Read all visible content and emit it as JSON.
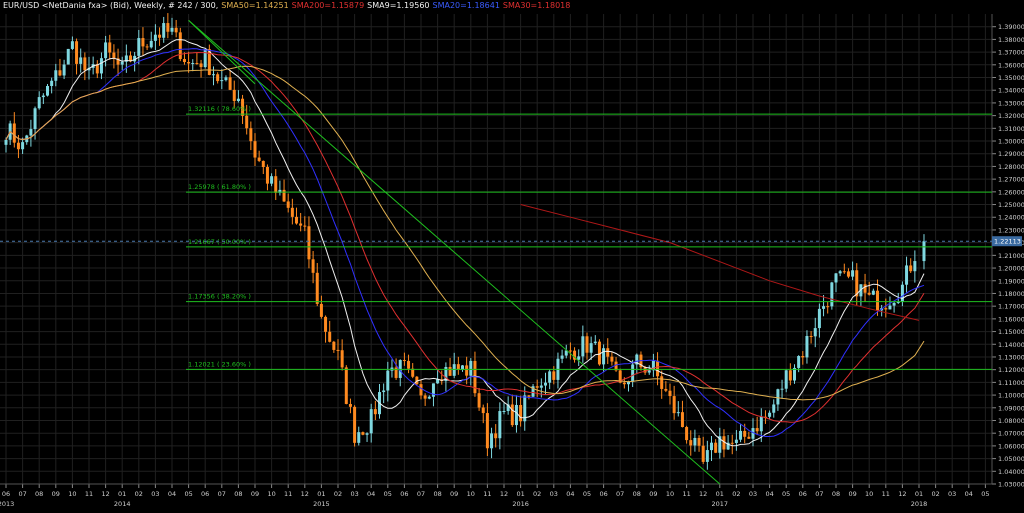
{
  "header": {
    "symbol": "EUR/USD <NetDania fxa> (Bid), Weekly, # 242 / 300,",
    "sma50": "SMA50=1.14251",
    "sma200": "SMA200=1.15879",
    "sma9": "SMA9=1.19560",
    "sma20": "SMA20=1.18641",
    "sma30": "SMA30=1.18018"
  },
  "colors": {
    "background": "#000000",
    "grid": "#202020",
    "bull": "#7fd8e0",
    "bear": "#ff8a20",
    "sma9": "#f0f0f0",
    "sma20": "#3030ff",
    "sma30": "#e03030",
    "sma50": "#e0b050",
    "sma200": "#b01818",
    "fib": "#1fbf1f",
    "price_box": "#3a6aa0"
  },
  "chart_data": {
    "type": "candlestick",
    "title": "EUR/USD <NetDania fxa> (Bid), Weekly, # 242 / 300,",
    "x_axis": {
      "months": [
        "06",
        "07",
        "08",
        "09",
        "10",
        "11",
        "12",
        "01",
        "02",
        "03",
        "04",
        "05",
        "06",
        "07",
        "08",
        "09",
        "10",
        "11",
        "12",
        "01",
        "02",
        "03",
        "04",
        "05",
        "06",
        "07",
        "08",
        "09",
        "10",
        "11",
        "12",
        "01",
        "02",
        "03",
        "04",
        "05",
        "06",
        "07",
        "08",
        "09",
        "10",
        "11",
        "12",
        "01",
        "02",
        "03",
        "04",
        "05",
        "06",
        "07",
        "08",
        "09",
        "10",
        "11",
        "12",
        "01",
        "02",
        "03",
        "04",
        "05"
      ],
      "years": [
        {
          "label": "2013",
          "at": "2013-06"
        },
        {
          "label": "2014",
          "at": "2014-01"
        },
        {
          "label": "2015",
          "at": "2015-01"
        },
        {
          "label": "2016",
          "at": "2016-01"
        },
        {
          "label": "2017",
          "at": "2017-01"
        },
        {
          "label": "2018",
          "at": "2018-01"
        }
      ],
      "start": "2013-06",
      "end": "2018-05"
    },
    "y_axis": {
      "min": 1.03,
      "max": 1.4,
      "step": 0.01,
      "side": "right",
      "ticks": [
        "1.03000",
        "1.04000",
        "1.05000",
        "1.06000",
        "1.07000",
        "1.08000",
        "1.09000",
        "1.10000",
        "1.11000",
        "1.12000",
        "1.13000",
        "1.14000",
        "1.15000",
        "1.16000",
        "1.17000",
        "1.18000",
        "1.19000",
        "1.20000",
        "1.21000",
        "1.22000",
        "1.23000",
        "1.24000",
        "1.25000",
        "1.26000",
        "1.27000",
        "1.28000",
        "1.29000",
        "1.30000",
        "1.31000",
        "1.32000",
        "1.33000",
        "1.34000",
        "1.35000",
        "1.36000",
        "1.37000",
        "1.38000",
        "1.39000"
      ]
    },
    "grid": true,
    "last_price": "1.22113",
    "last_price_value": 1.22113,
    "fib_levels": [
      {
        "label": "1.32116 ( 78.60% )",
        "value": 1.32116
      },
      {
        "label": "1.25978 ( 61.80% )",
        "value": 1.25978
      },
      {
        "label": "1.21667 ( 50.00% )",
        "value": 1.21667
      },
      {
        "label": "1.17356 ( 38.20% )",
        "value": 1.17356
      },
      {
        "label": "1.12021 ( 23.60% )",
        "value": 1.12021
      }
    ],
    "trendlines": [
      {
        "from": [
          "2014-05",
          1.395
        ],
        "to": [
          "2017-01",
          1.03
        ]
      },
      {
        "from": [
          "2014-05",
          1.395
        ],
        "to": [
          "2014-09",
          1.345
        ]
      }
    ],
    "price_path": [
      [
        "2013-06",
        1.31
      ],
      [
        "2013-07",
        1.295
      ],
      [
        "2013-08",
        1.33
      ],
      [
        "2013-09",
        1.35
      ],
      [
        "2013-10",
        1.375
      ],
      [
        "2013-11",
        1.35
      ],
      [
        "2013-12",
        1.37
      ],
      [
        "2014-01",
        1.355
      ],
      [
        "2014-02",
        1.375
      ],
      [
        "2014-03",
        1.385
      ],
      [
        "2014-04",
        1.385
      ],
      [
        "2014-05",
        1.36
      ],
      [
        "2014-06",
        1.365
      ],
      [
        "2014-07",
        1.345
      ],
      [
        "2014-08",
        1.335
      ],
      [
        "2014-09",
        1.29
      ],
      [
        "2014-10",
        1.265
      ],
      [
        "2014-11",
        1.245
      ],
      [
        "2014-12",
        1.225
      ],
      [
        "2015-01",
        1.16
      ],
      [
        "2015-02",
        1.13
      ],
      [
        "2015-03",
        1.07
      ],
      [
        "2015-04",
        1.08
      ],
      [
        "2015-05",
        1.12
      ],
      [
        "2015-06",
        1.12
      ],
      [
        "2015-07",
        1.095
      ],
      [
        "2015-08",
        1.12
      ],
      [
        "2015-09",
        1.12
      ],
      [
        "2015-10",
        1.12
      ],
      [
        "2015-11",
        1.065
      ],
      [
        "2015-12",
        1.085
      ],
      [
        "2016-01",
        1.085
      ],
      [
        "2016-02",
        1.11
      ],
      [
        "2016-03",
        1.12
      ],
      [
        "2016-04",
        1.135
      ],
      [
        "2016-05",
        1.14
      ],
      [
        "2016-06",
        1.13
      ],
      [
        "2016-07",
        1.105
      ],
      [
        "2016-08",
        1.125
      ],
      [
        "2016-09",
        1.12
      ],
      [
        "2016-10",
        1.095
      ],
      [
        "2016-11",
        1.07
      ],
      [
        "2016-12",
        1.045
      ],
      [
        "2017-01",
        1.065
      ],
      [
        "2017-02",
        1.06
      ],
      [
        "2017-03",
        1.075
      ],
      [
        "2017-04",
        1.085
      ],
      [
        "2017-05",
        1.115
      ],
      [
        "2017-06",
        1.135
      ],
      [
        "2017-07",
        1.165
      ],
      [
        "2017-08",
        1.19
      ],
      [
        "2017-09",
        1.19
      ],
      [
        "2017-10",
        1.175
      ],
      [
        "2017-11",
        1.175
      ],
      [
        "2017-12",
        1.185
      ],
      [
        "2018-01",
        1.22113
      ]
    ],
    "series": [
      {
        "name": "SMA9=1.19560",
        "lag": 2.5,
        "end": [
          "2018-01",
          1.1956
        ]
      },
      {
        "name": "SMA20=1.18641",
        "lag": 5,
        "end": [
          "2018-01",
          1.18641
        ]
      },
      {
        "name": "SMA30=1.18018",
        "lag": 7.5,
        "end": [
          "2018-01",
          1.18018
        ]
      },
      {
        "name": "SMA50=1.14251",
        "lag": 12,
        "end": [
          "2018-01",
          1.14251
        ]
      },
      {
        "name": "SMA200=1.15879",
        "points": [
          [
            "2016-01",
            1.25
          ],
          [
            "2016-04",
            1.24
          ],
          [
            "2016-07",
            1.23
          ],
          [
            "2016-10",
            1.22
          ],
          [
            "2017-01",
            1.205
          ],
          [
            "2017-04",
            1.19
          ],
          [
            "2017-07",
            1.178
          ],
          [
            "2017-10",
            1.168
          ],
          [
            "2018-01",
            1.15879
          ]
        ]
      }
    ]
  }
}
